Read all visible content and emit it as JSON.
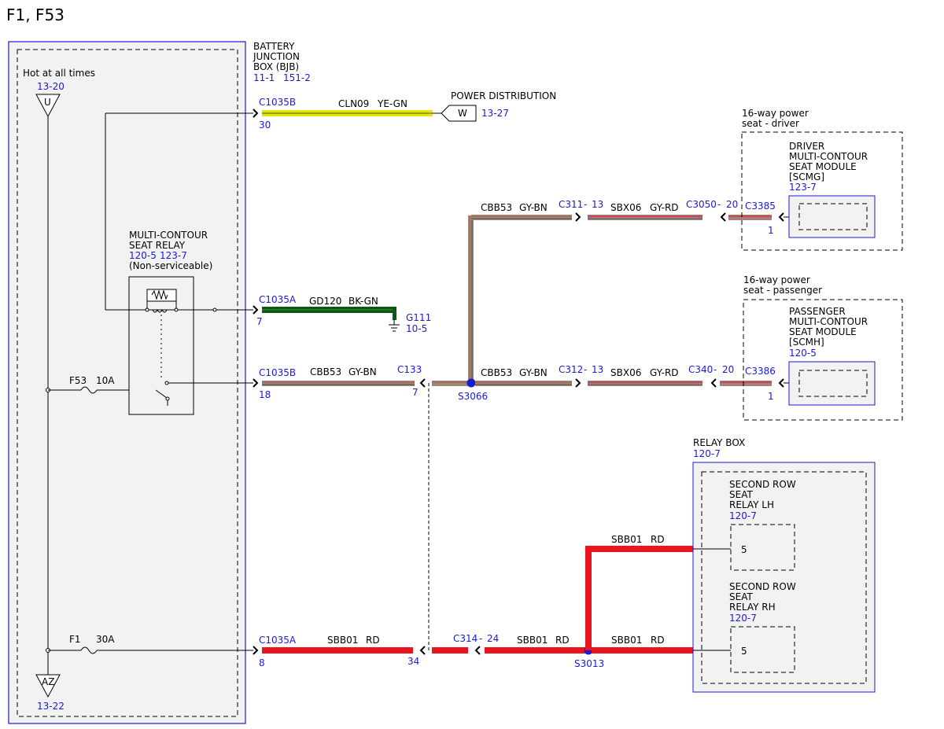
{
  "title": "F1, F53",
  "colors": {
    "blue": "#1a1ad6",
    "red": "#e8141e",
    "ye_gn": "#e6e600",
    "bk_gn": "#0a5a14",
    "gy_bn": "#8a8a8a",
    "gy_rd": "#9a9a9a",
    "box_fill": "#f2f2f2"
  },
  "bjb": {
    "line1": "BATTERY",
    "line2": "JUNCTION",
    "line3": "BOX (BJB)",
    "ref1": "11-1",
    "ref2": "151-2"
  },
  "hot": {
    "label": "Hot at all times",
    "top_ref": "13-20",
    "top_letter": "U",
    "bottom_letter": "AZ",
    "bottom_ref": "13-22"
  },
  "relay": {
    "line1": "MULTI-CONTOUR",
    "line2": "SEAT RELAY",
    "ref1": "120-5",
    "ref2": "123-7",
    "note": "(Non-serviceable)"
  },
  "fuses": {
    "f53": "F53",
    "f53_rating": "10A",
    "f1": "F1",
    "f1_rating": "30A"
  },
  "row1": {
    "connector": "C1035B",
    "pin": "30",
    "circuit": "CLN09",
    "color": "YE-GN",
    "dest_label": "POWER DISTRIBUTION",
    "dest_letter": "W",
    "dest_ref": "13-27"
  },
  "row2": {
    "connector": "C1035A",
    "pin": "7",
    "circuit": "GD120",
    "color": "BK-GN",
    "ground": "G111",
    "ground_ref": "10-5"
  },
  "row3": {
    "connector": "C1035B",
    "pin": "18",
    "circuit": "CBB53",
    "color": "GY-BN",
    "c133": "C133",
    "c133_pin": "7",
    "splice": "S3066"
  },
  "driver": {
    "circuit": "CBB53",
    "color": "GY-BN",
    "inline1": "C311",
    "inline1_pin": "13",
    "circuit2": "SBX06",
    "color2": "GY-RD",
    "inline2": "C3050",
    "inline2_pin": "20",
    "connector": "C3385",
    "pin": "1",
    "header1": "16-way power",
    "header2": "seat - driver",
    "m1": "DRIVER",
    "m2": "MULTI-CONTOUR",
    "m3": "SEAT MODULE",
    "m4": "[SCMG]",
    "ref": "123-7"
  },
  "passenger": {
    "circuit": "CBB53",
    "color": "GY-BN",
    "inline1": "C312",
    "inline1_pin": "13",
    "circuit2": "SBX06",
    "color2": "GY-RD",
    "inline2": "C340",
    "inline2_pin": "20",
    "connector": "C3386",
    "pin": "1",
    "header1": "16-way power",
    "header2": "seat - passenger",
    "m1": "PASSENGER",
    "m2": "MULTI-CONTOUR",
    "m3": "SEAT MODULE",
    "m4": "[SCMH]",
    "ref": "120-5"
  },
  "row4": {
    "connector": "C1035A",
    "pin": "8",
    "circuit": "SBB01",
    "color": "RD",
    "pin2": "34",
    "inline": "C314",
    "inline_pin": "24",
    "splice": "S3013"
  },
  "relay_box": {
    "label": "RELAY BOX",
    "ref": "120-7",
    "lh1": "SECOND ROW",
    "lh2": "SEAT",
    "lh3": "RELAY LH",
    "lh_ref": "120-7",
    "lh_pin": "5",
    "rh1": "SECOND ROW",
    "rh2": "SEAT",
    "rh3": "RELAY RH",
    "rh_ref": "120-7",
    "rh_pin": "5",
    "w_up_circuit": "SBB01",
    "w_up_color": "RD",
    "w_rh_circuit": "SBB01",
    "w_rh_color": "RD"
  },
  "dash": "-"
}
